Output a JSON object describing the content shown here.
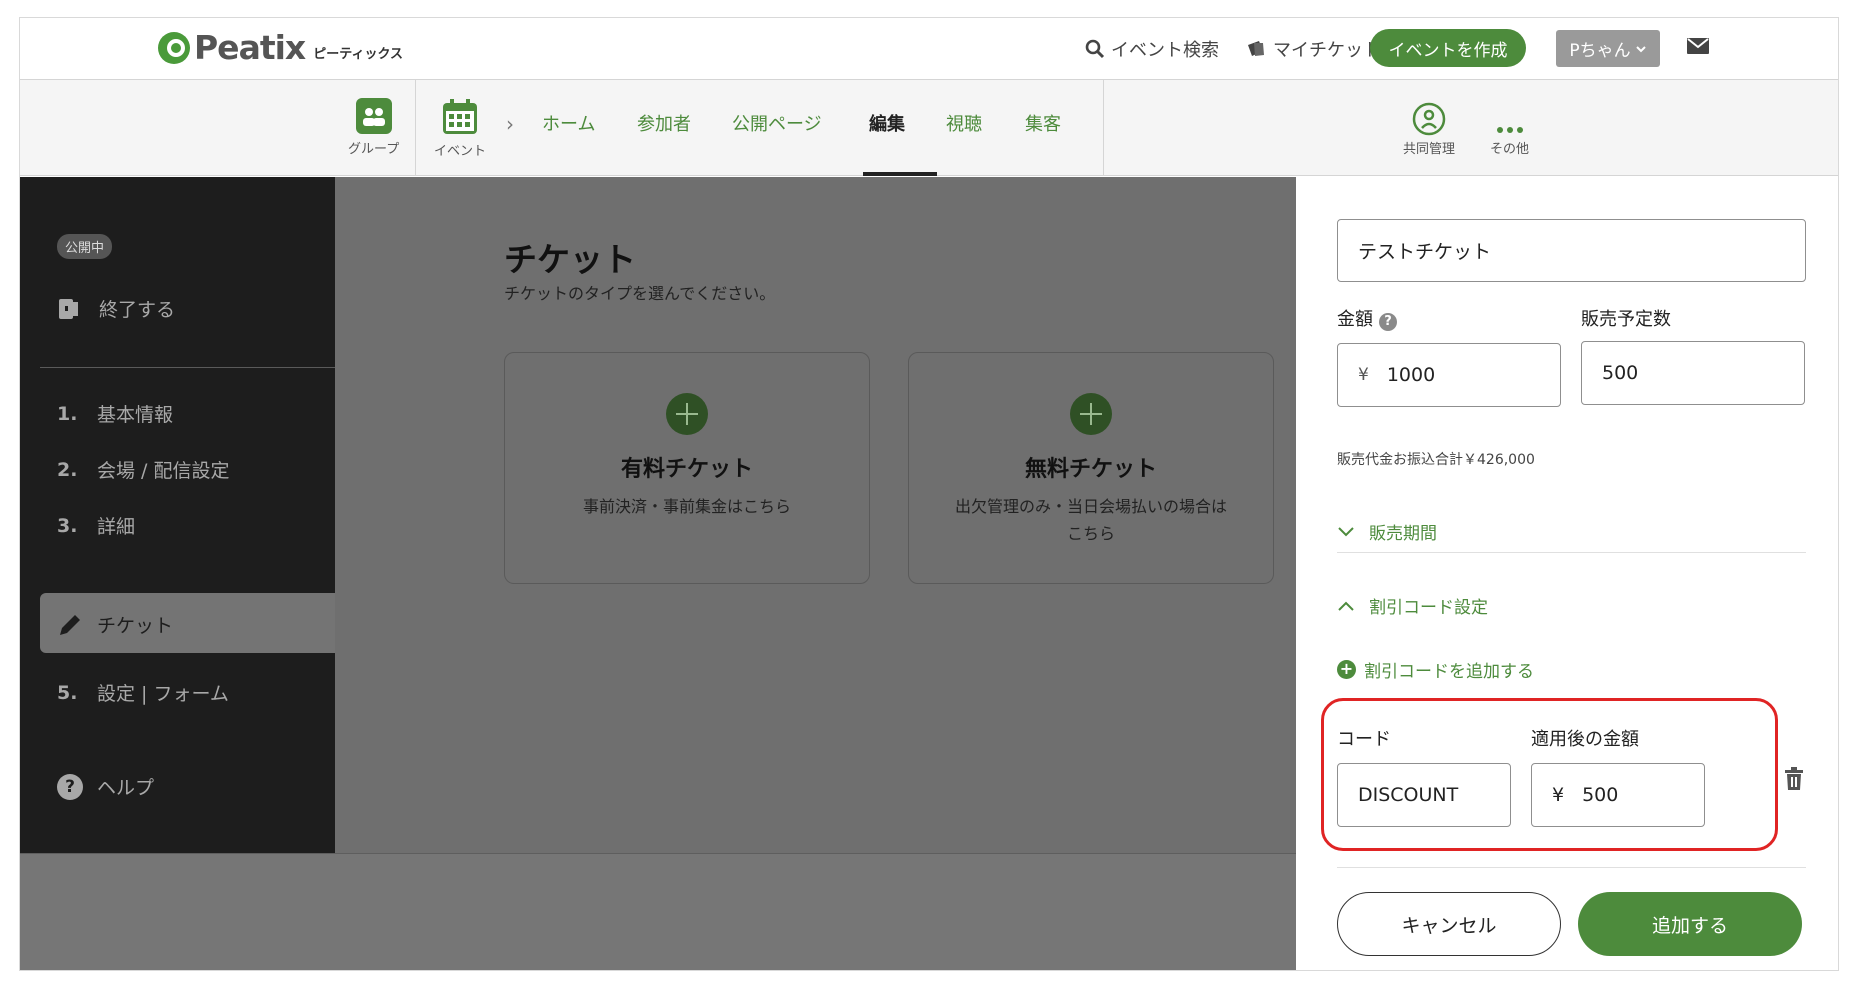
{
  "header": {
    "logo_word": "Peatix",
    "logo_kana": "ピーティックス",
    "search_label": "イベント検索",
    "my_tickets_label": "マイチケット",
    "create_button": "イベントを作成",
    "user_button": "Pちゃん",
    "brand_color": "#4d8b3c"
  },
  "subnav": {
    "group_label": "グループ",
    "event_label": "イベント",
    "tabs": [
      {
        "label": "ホーム"
      },
      {
        "label": "参加者"
      },
      {
        "label": "公開ページ"
      },
      {
        "label": "編集",
        "active": true
      },
      {
        "label": "視聴"
      },
      {
        "label": "集客"
      }
    ],
    "co_manage_label": "共同管理",
    "more_label": "その他"
  },
  "sidebar": {
    "status": "公開中",
    "end_label": "終了する",
    "items": [
      {
        "num": "1.",
        "label": "基本情報"
      },
      {
        "num": "2.",
        "label": "会場 / 配信設定"
      },
      {
        "num": "3.",
        "label": "詳細"
      },
      {
        "num": "",
        "label": "チケット"
      },
      {
        "num": "5.",
        "label": "設定 | フォーム"
      }
    ],
    "help_label": "ヘルプ"
  },
  "main": {
    "title": "チケット",
    "subtitle": "チケットのタイプを選んでください。",
    "cards": [
      {
        "title": "有料チケット",
        "desc": "事前決済・事前集金はこちら"
      },
      {
        "title": "無料チケット",
        "desc": "出欠管理のみ・当日会場払いの場合はこちら"
      }
    ]
  },
  "panel": {
    "ticket_name": "テストチケット",
    "price_label": "金額",
    "quantity_label": "販売予定数",
    "currency": "¥",
    "price_value": "1000",
    "quantity_value": "500",
    "sales_total": "販売代金お振込合計￥426,000",
    "sales_period_label": "販売期間",
    "discount_section_label": "割引コード設定",
    "add_discount_label": "割引コードを追加する",
    "code_label": "コード",
    "discounted_price_label": "適用後の金額",
    "code_value": "DISCOUNT",
    "discounted_price_value": "500",
    "cancel_button": "キャンセル",
    "add_button": "追加する"
  }
}
